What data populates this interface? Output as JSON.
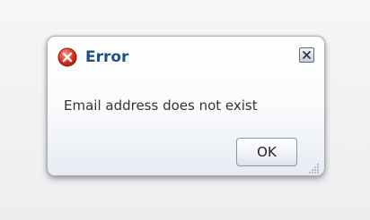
{
  "dialog": {
    "title": "Error",
    "message": "Email address does not exist",
    "ok_label": "OK",
    "title_color": "#1f4f87",
    "icons": {
      "status": "error-icon",
      "close": "close-icon",
      "resize": "resize-grip-icon"
    },
    "error_icon_color": "#d52b1e"
  }
}
